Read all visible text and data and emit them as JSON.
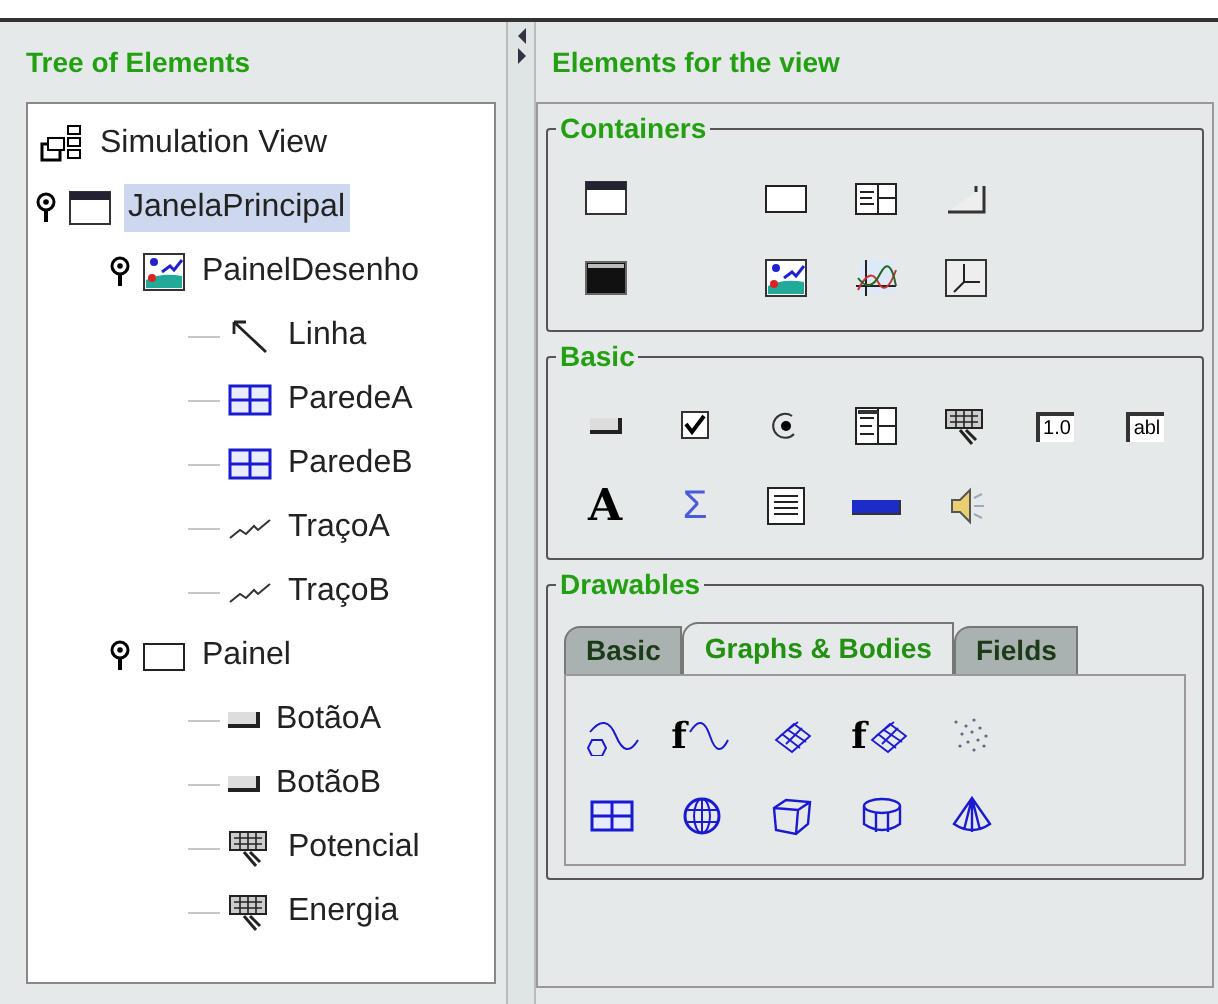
{
  "tree": {
    "title": "Tree of Elements",
    "root": {
      "label": "Simulation View",
      "kind": "view",
      "selected": false,
      "children": [
        {
          "label": "JanelaPrincipal",
          "kind": "window",
          "selected": true,
          "expanded": true,
          "children": [
            {
              "label": "PainelDesenho",
              "kind": "drawing-panel",
              "selected": false,
              "expanded": true,
              "children": [
                {
                  "label": "Linha",
                  "kind": "arrow",
                  "selected": false
                },
                {
                  "label": "ParedeA",
                  "kind": "grid",
                  "selected": false
                },
                {
                  "label": "ParedeB",
                  "kind": "grid",
                  "selected": false
                },
                {
                  "label": "TraçoA",
                  "kind": "trace",
                  "selected": false
                },
                {
                  "label": "TraçoB",
                  "kind": "trace",
                  "selected": false
                }
              ]
            },
            {
              "label": "Painel",
              "kind": "panel",
              "selected": false,
              "expanded": true,
              "children": [
                {
                  "label": "BotãoA",
                  "kind": "button",
                  "selected": false
                },
                {
                  "label": "BotãoB",
                  "kind": "button",
                  "selected": false
                },
                {
                  "label": "Potencial",
                  "kind": "hand",
                  "selected": false
                },
                {
                  "label": "Energia",
                  "kind": "hand",
                  "selected": false
                }
              ]
            }
          ]
        }
      ]
    }
  },
  "palette": {
    "title": "Elements for the view",
    "groups": [
      {
        "title": "Containers",
        "rows": [
          [
            {
              "kind": "window"
            },
            {
              "kind": "blank"
            },
            {
              "kind": "panel"
            },
            {
              "kind": "split"
            },
            {
              "kind": "tabbed"
            }
          ],
          [
            {
              "kind": "dialog"
            },
            {
              "kind": "blank"
            },
            {
              "kind": "drawing-panel"
            },
            {
              "kind": "plot"
            },
            {
              "kind": "axes"
            }
          ]
        ]
      },
      {
        "title": "Basic",
        "rows": [
          [
            {
              "kind": "button"
            },
            {
              "kind": "checkbox"
            },
            {
              "kind": "radio"
            },
            {
              "kind": "combo"
            },
            {
              "kind": "hand"
            },
            {
              "kind": "field",
              "glyph": "1.0"
            },
            {
              "kind": "field",
              "glyph": "abl"
            }
          ],
          [
            {
              "kind": "letter",
              "glyph": "A"
            },
            {
              "kind": "sigma",
              "glyph": "Σ"
            },
            {
              "kind": "textarea"
            },
            {
              "kind": "bar"
            },
            {
              "kind": "speaker"
            }
          ]
        ]
      },
      {
        "title": "Drawables",
        "tabs": [
          {
            "label": "Basic",
            "selected": false
          },
          {
            "label": "Graphs & Bodies",
            "selected": true
          },
          {
            "label": "Fields",
            "selected": false
          }
        ],
        "rows": [
          [
            {
              "kind": "curve"
            },
            {
              "kind": "fcurve",
              "glyph": "f"
            },
            {
              "kind": "surface"
            },
            {
              "kind": "fsurface",
              "glyph": "f"
            },
            {
              "kind": "dots"
            }
          ],
          [
            {
              "kind": "grid"
            },
            {
              "kind": "sphere"
            },
            {
              "kind": "box"
            },
            {
              "kind": "cylinder"
            },
            {
              "kind": "cone"
            }
          ]
        ]
      }
    ]
  }
}
